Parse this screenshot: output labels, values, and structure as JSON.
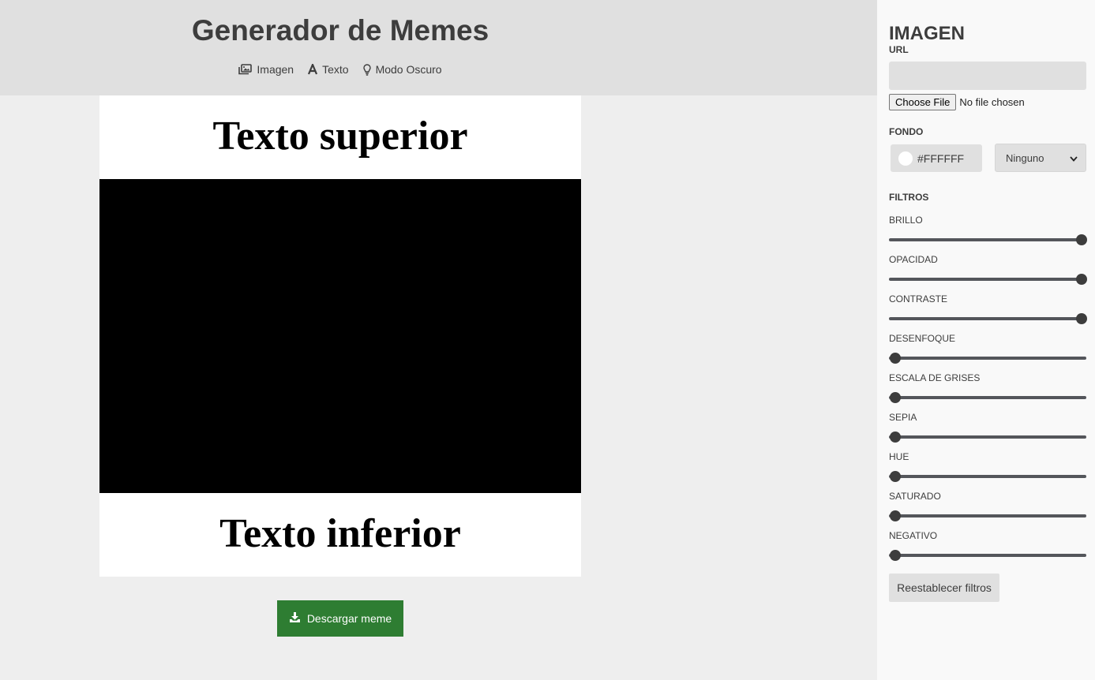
{
  "header": {
    "title": "Generador de Memes",
    "nav": [
      {
        "label": "Imagen",
        "icon": "images-icon"
      },
      {
        "label": "Texto",
        "icon": "font-icon"
      },
      {
        "label": "Modo Oscuro",
        "icon": "lightbulb-icon"
      }
    ]
  },
  "meme": {
    "top_text": "Texto superior",
    "bottom_text": "Texto inferior",
    "image_color": "#000000"
  },
  "download": {
    "label": "Descargar meme",
    "icon": "download-icon",
    "color": "#2e7d32"
  },
  "panel": {
    "title": "IMAGEN",
    "url_label": "URL",
    "url_value": "",
    "file_button": "Choose File",
    "file_status": "No file chosen",
    "background_label": "FONDO",
    "background_color": "#FFFFFF",
    "blend_select": "Ninguno",
    "filters_label": "FILTROS",
    "filters": [
      {
        "label": "BRILLO",
        "value": 1
      },
      {
        "label": "OPACIDAD",
        "value": 1
      },
      {
        "label": "CONTRASTE",
        "value": 1
      },
      {
        "label": "DESENFOQUE",
        "value": 0
      },
      {
        "label": "ESCALA DE GRISES",
        "value": 0
      },
      {
        "label": "SEPIA",
        "value": 0
      },
      {
        "label": "HUE",
        "value": 0
      },
      {
        "label": "SATURADO",
        "value": 0
      },
      {
        "label": "NEGATIVO",
        "value": 0
      }
    ],
    "reset_label": "Reestablecer filtros"
  }
}
